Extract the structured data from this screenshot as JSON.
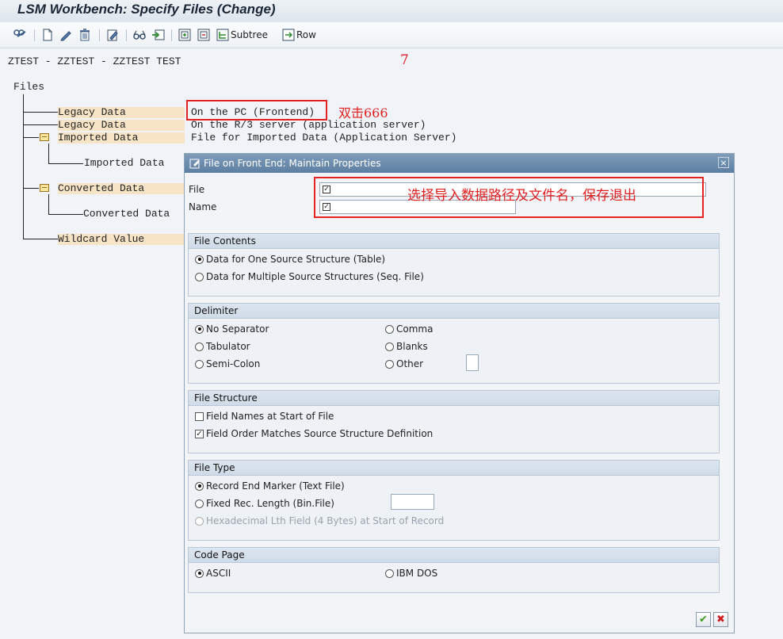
{
  "window": {
    "title": "LSM Workbench: Specify Files (Change)"
  },
  "toolbar": {
    "icons": [
      "other-object-icon",
      "create-icon",
      "edit-icon",
      "delete-icon",
      "change-icon",
      "glasses-icon",
      "transfer-icon",
      "expand-icon",
      "collapse-icon"
    ],
    "subtree_label": "Subtree",
    "row_label": "Row"
  },
  "header_line": "ZTEST - ZZTEST - ZZTEST TEST",
  "tree": {
    "root": "Files",
    "nodes": {
      "legacy_pc": "Legacy Data",
      "legacy_server": "Legacy Data",
      "imported": "Imported Data",
      "imported_child": "Imported Data",
      "converted": "Converted Data",
      "converted_child": "Converted Data",
      "wildcard": "Wildcard Value"
    },
    "values": {
      "legacy_pc": "On the PC (Frontend)",
      "legacy_server": "On the R/3 server (application server)",
      "imported": "File for Imported Data (Application Server)"
    }
  },
  "annotations": {
    "number": "7",
    "double_click": "双击666",
    "instruction": "选择导入数据路径及文件名，保存退出"
  },
  "dialog": {
    "title": "File on Front End: Maintain Properties",
    "close_glyph": "×",
    "file_label": "File",
    "name_label": "Name",
    "file_value": "",
    "name_value": "",
    "file_contents": {
      "title": "File Contents",
      "option_one": "Data for One Source Structure (Table)",
      "option_multiple": "Data for Multiple Source Structures (Seq. File)",
      "selected": "option_one"
    },
    "delimiter": {
      "title": "Delimiter",
      "no_separator": "No Separator",
      "tabulator": "Tabulator",
      "semicolon": "Semi-Colon",
      "comma": "Comma",
      "blanks": "Blanks",
      "other": "Other",
      "other_value": "",
      "selected": "no_separator"
    },
    "file_structure": {
      "title": "File Structure",
      "field_names": "Field Names at Start of File",
      "field_names_checked": false,
      "field_order": "Field Order Matches Source Structure Definition",
      "field_order_checked": true
    },
    "file_type": {
      "title": "File Type",
      "record_end": "Record End Marker (Text File)",
      "fixed_length": "Fixed Rec. Length (Bin.File)",
      "fixed_length_value": "",
      "hex_length": "Hexadecimal Lth Field (4 Bytes) at Start of Record",
      "selected": "record_end"
    },
    "code_page": {
      "title": "Code Page",
      "ascii": "ASCII",
      "ibm_dos": "IBM DOS",
      "selected": "ascii"
    },
    "buttons": {
      "ok_glyph": "✔",
      "cancel_glyph": "✖"
    },
    "colors": {
      "ok": "#3a9a1e",
      "cancel": "#cc2020"
    }
  }
}
